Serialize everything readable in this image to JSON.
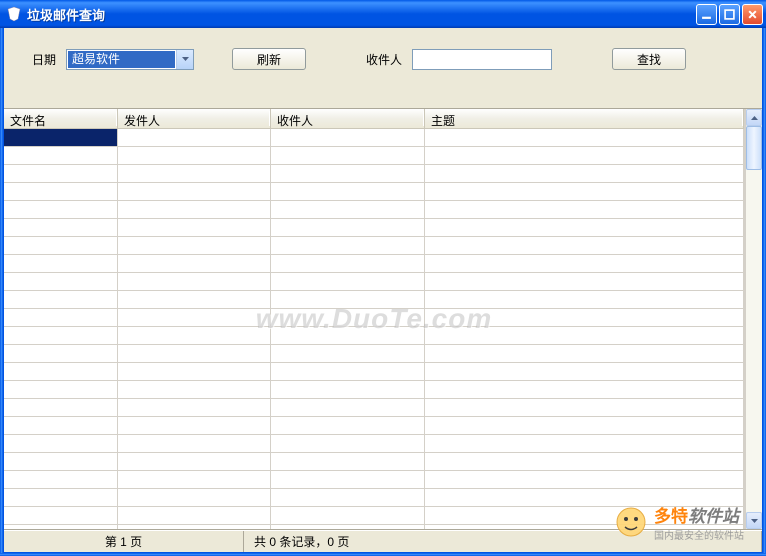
{
  "window": {
    "title": "垃圾邮件查询"
  },
  "filter": {
    "date_label": "日期",
    "date_value": "超易软件",
    "refresh_label": "刷新",
    "recipient_label": "收件人",
    "recipient_value": "",
    "search_label": "查找"
  },
  "table": {
    "columns": [
      "文件名",
      "发件人",
      "收件人",
      "主题"
    ],
    "rows": []
  },
  "status": {
    "page_text": "第 1 页",
    "count_text": "共 0 条记录，0 页"
  },
  "watermark": "www.DuoTe.com",
  "promo": {
    "brand_main": "多特",
    "brand_sub": "软件站",
    "tagline": "国内最安全的软件站"
  }
}
